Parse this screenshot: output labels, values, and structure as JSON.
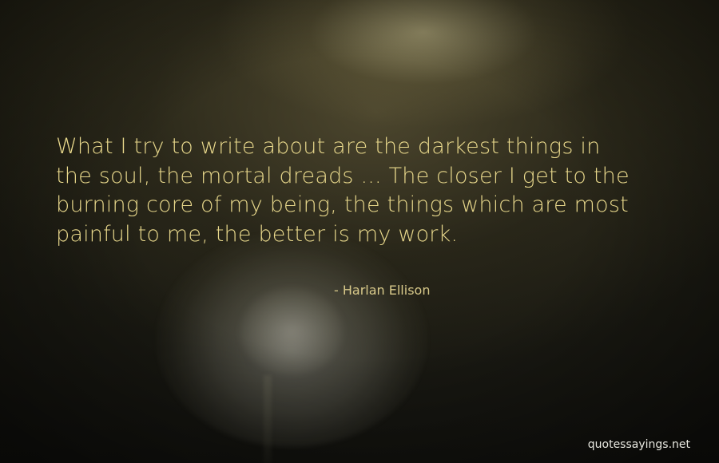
{
  "background": {
    "description_icon": "dandelion-photo",
    "accent_color": "#e7d78b"
  },
  "quote": {
    "lines": [
      "What I try to write about are the darkest things in",
      "the soul, the mortal dreads ... The closer I get to the",
      "burning core of my being, the things which are most",
      "painful to me, the better is my work."
    ]
  },
  "author": "- Harlan Ellison",
  "watermark": "quotessayings.net"
}
